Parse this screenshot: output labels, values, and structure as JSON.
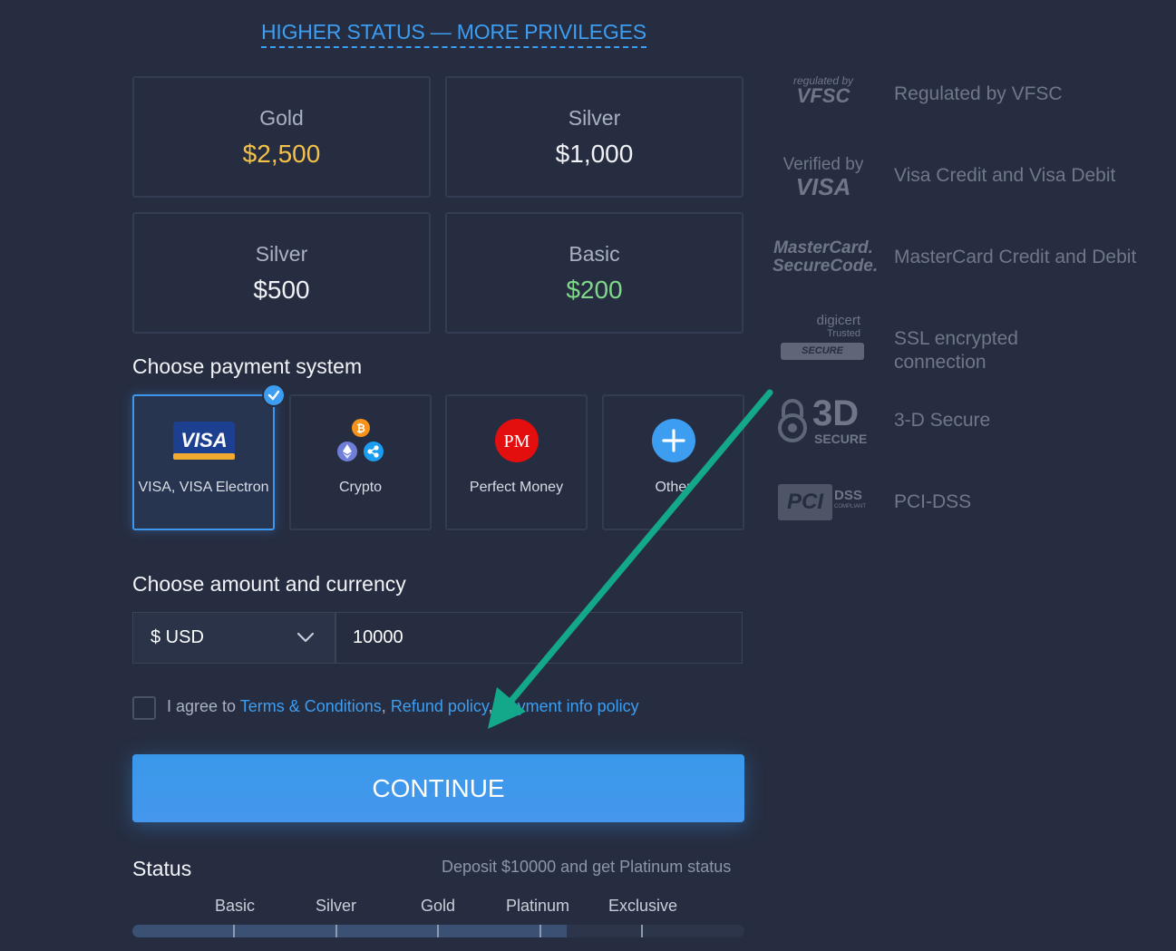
{
  "header": {
    "status_link": "HIGHER STATUS — MORE PRIVILEGES"
  },
  "tiers": [
    {
      "name": "Gold",
      "amount": "$2,500",
      "color": "#f4c046"
    },
    {
      "name": "Silver",
      "amount": "$1,000",
      "color": "#f0f2f6"
    },
    {
      "name": "Silver",
      "amount": "$500",
      "color": "#f0f2f6"
    },
    {
      "name": "Basic",
      "amount": "$200",
      "color": "#7fd88a"
    }
  ],
  "payment": {
    "title": "Choose payment system",
    "methods": [
      {
        "label": "VISA, VISA Electron",
        "icon": "visa-icon",
        "selected": true
      },
      {
        "label": "Crypto",
        "icon": "crypto-icon",
        "selected": false
      },
      {
        "label": "Perfect Money",
        "icon": "perfect-money-icon",
        "selected": false
      },
      {
        "label": "Other",
        "icon": "plus-icon",
        "selected": false
      }
    ]
  },
  "amount": {
    "title": "Choose amount and currency",
    "currency": "$ USD",
    "value": "10000"
  },
  "agree": {
    "prefix": "I agree to ",
    "terms": "Terms & Conditions",
    "sep1": ", ",
    "refund": "Refund policy",
    "sep2": ", ",
    "payment_info": "Payment info policy"
  },
  "continue_label": "CONTINUE",
  "status": {
    "title": "Status",
    "note": "Deposit $10000 and get Platinum status",
    "stages": [
      "Basic",
      "Silver",
      "Gold",
      "Platinum",
      "Exclusive"
    ],
    "progress_percent": 71
  },
  "trust": [
    {
      "label": "Regulated by VFSC",
      "icon": "vfsc-icon",
      "logo_top": "regulated by",
      "logo_main": "VFSC"
    },
    {
      "label": "Visa Credit and Visa Debit",
      "icon": "verified-by-visa-icon",
      "logo_top": "Verified by",
      "logo_main": "VISA"
    },
    {
      "label": "MasterCard Credit and Debit",
      "icon": "mastercard-securecode-icon",
      "logo_top": "MasterCard.",
      "logo_main": "SecureCode."
    },
    {
      "label": "SSL encrypted connection",
      "icon": "digicert-icon",
      "logo_top": "digicert",
      "logo_sub": "Trusted",
      "logo_main": "SECURE"
    },
    {
      "label": "3-D Secure",
      "icon": "3d-secure-icon",
      "logo_top": "3D",
      "logo_main": "SECURE"
    },
    {
      "label": "PCI-DSS",
      "icon": "pci-dss-icon",
      "logo_top": "PCI",
      "logo_main": "DSS",
      "logo_sub": "COMPLIANT"
    }
  ],
  "colors": {
    "accent": "#3d9df0",
    "background": "#262d41",
    "annotation_arrow": "#13a88a"
  }
}
